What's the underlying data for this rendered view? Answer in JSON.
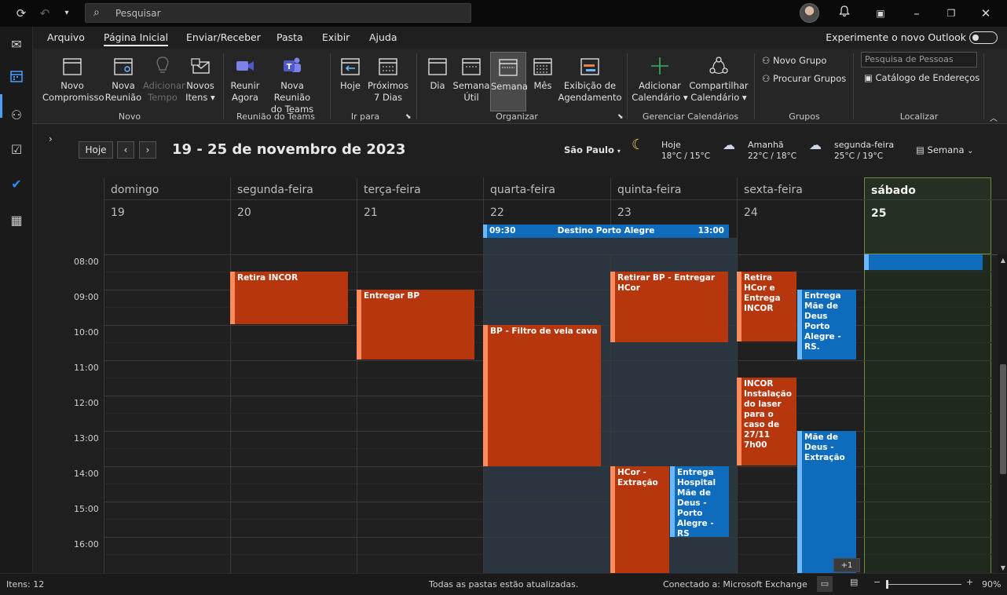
{
  "search": {
    "placeholder": "Pesquisar"
  },
  "menu": {
    "items": [
      "Arquivo",
      "Página Inicial",
      "Enviar/Receber",
      "Pasta",
      "Exibir",
      "Ajuda"
    ],
    "try_new": "Experimente o novo Outlook"
  },
  "ribbon": {
    "novo": {
      "compromisso": [
        "Novo",
        "Compromisso"
      ],
      "reuniao": [
        "Nova",
        "Reunião"
      ],
      "adicionar_tempo": [
        "Adicionar",
        "Tempo"
      ],
      "novos_itens": [
        "Novos",
        "Itens"
      ],
      "label": "Novo"
    },
    "teams": {
      "reunir": [
        "Reunir",
        "Agora"
      ],
      "nova_reuniao": [
        "Nova Reunião",
        "do Teams"
      ],
      "label": "Reunião do Teams"
    },
    "ir_para": {
      "hoje": "Hoje",
      "proximos": [
        "Próximos",
        "7 Dias"
      ],
      "label": "Ir para"
    },
    "organizar": {
      "dia": "Dia",
      "semana_util": [
        "Semana",
        "Útil"
      ],
      "semana": "Semana",
      "mes": "Mês",
      "agendamento": [
        "Exibição de",
        "Agendamento"
      ],
      "label": "Organizar"
    },
    "gerenciar": {
      "adicionar": [
        "Adicionar",
        "Calendário"
      ],
      "compartilhar": [
        "Compartilhar",
        "Calendário"
      ],
      "label": "Gerenciar Calendários"
    },
    "grupos": {
      "novo": "Novo Grupo",
      "procurar": "Procurar Grupos",
      "label": "Grupos"
    },
    "localizar": {
      "pesquisa": "Pesquisa de Pessoas",
      "catalogo": "Catálogo de Endereços",
      "label": "Localizar"
    }
  },
  "calendar": {
    "hoje_btn": "Hoje",
    "range_title": "19 - 25 de novembro de 2023",
    "city": "São Paulo",
    "weather": [
      {
        "day": "Hoje",
        "temp": "18°C / 15°C",
        "icon": "partly-cloudy-night-icon"
      },
      {
        "day": "Amanhã",
        "temp": "22°C / 18°C",
        "icon": "rain-icon"
      },
      {
        "day": "segunda-feira",
        "temp": "25°C / 19°C",
        "icon": "rain-icon"
      }
    ],
    "view": "Semana",
    "days": [
      {
        "name": "domingo",
        "date": "19"
      },
      {
        "name": "segunda-feira",
        "date": "20"
      },
      {
        "name": "terça-feira",
        "date": "21"
      },
      {
        "name": "quarta-feira",
        "date": "22"
      },
      {
        "name": "quinta-feira",
        "date": "23"
      },
      {
        "name": "sexta-feira",
        "date": "24"
      },
      {
        "name": "sábado",
        "date": "25"
      }
    ],
    "hours": [
      "08:00",
      "09:00",
      "10:00",
      "11:00",
      "12:00",
      "13:00",
      "14:00",
      "15:00",
      "16:00"
    ],
    "allday_event": {
      "start": "09:30",
      "title": "Destino Porto Alegre",
      "end": "13:00"
    },
    "events": [
      {
        "title": "Retira INCOR"
      },
      {
        "title": "Entregar BP"
      },
      {
        "title": "BP - Filtro de veia cava"
      },
      {
        "title": "Retirar BP - Entregar HCor"
      },
      {
        "title": "HCor - Extração"
      },
      {
        "title": "Entrega Hospital Mãe de Deus - Porto Alegre - RS"
      },
      {
        "title": "Retira HCor e Entrega INCOR"
      },
      {
        "title": "Entrega Mãe de Deus Porto Alegre - RS."
      },
      {
        "title": "INCOR Instalação do laser para o caso de 27/11 7h00"
      },
      {
        "title": "Mãe de Deus - Extração"
      },
      {
        "title": ""
      }
    ],
    "more": "+1"
  },
  "status": {
    "items": "Itens: 12",
    "sync": "Todas as pastas estão atualizadas.",
    "connection": "Conectado a: Microsoft Exchange",
    "zoom": "90%"
  }
}
